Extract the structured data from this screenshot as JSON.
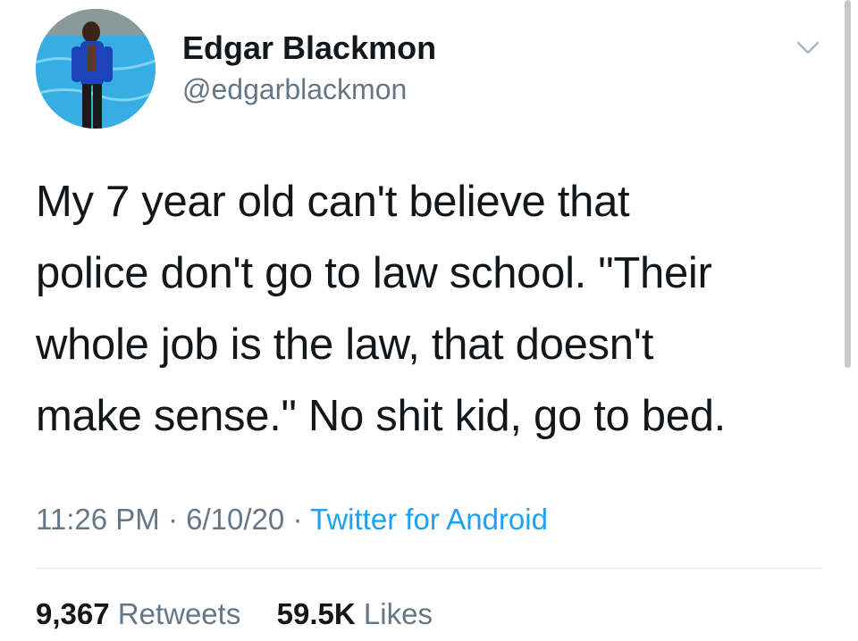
{
  "tweet": {
    "display_name": "Edgar Blackmon",
    "handle": "@edgarblackmon",
    "avatar_icon": "profile-photo",
    "menu_icon": "chevron-down-icon",
    "text_lines": [
      "My 7 year old can't believe that",
      "police don't go to law school. \"Their",
      "whole job is the law, that doesn't",
      "make sense.\" No shit kid, go to bed."
    ],
    "time": "11:26 PM",
    "date": "6/10/20",
    "separator": "·",
    "source": "Twitter for Android",
    "retweets_count": "9,367",
    "retweets_label": "Retweets",
    "likes_count": "59.5K",
    "likes_label": "Likes"
  },
  "colors": {
    "text": "#14171a",
    "secondary": "#657786",
    "link": "#1da1f2",
    "divider": "#e6ecf0"
  }
}
